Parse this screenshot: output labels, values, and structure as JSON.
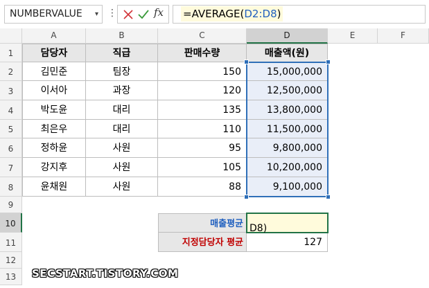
{
  "formula_bar": {
    "name_box": "NUMBERVALUE",
    "formula_prefix": "=AVERAGE(",
    "formula_ref": "D2:D8",
    "formula_suffix": ")",
    "fx_label": "fx"
  },
  "columns": [
    "A",
    "B",
    "C",
    "D",
    "E",
    "F"
  ],
  "rows": [
    "1",
    "2",
    "3",
    "4",
    "5",
    "6",
    "7",
    "8",
    "9",
    "10",
    "11",
    "12",
    "13"
  ],
  "table": {
    "headers": [
      "담당자",
      "직급",
      "판매수량",
      "매출액(원)"
    ],
    "rows": [
      [
        "김민준",
        "팀장",
        "150",
        "15,000,000"
      ],
      [
        "이서아",
        "과장",
        "120",
        "12,500,000"
      ],
      [
        "박도윤",
        "대리",
        "135",
        "13,800,000"
      ],
      [
        "최은우",
        "대리",
        "110",
        "11,500,000"
      ],
      [
        "정하윤",
        "사원",
        "95",
        "9,800,000"
      ],
      [
        "강지후",
        "사원",
        "105",
        "10,200,000"
      ],
      [
        "윤채원",
        "사원",
        "88",
        "9,100,000"
      ]
    ]
  },
  "summary": {
    "sales_avg_label": "매출평균",
    "sales_avg_editing": "D8)",
    "designated_avg_label": "지정담당자 평균",
    "designated_avg_value": "127"
  },
  "watermark": "SECSTART.TISTORY.COM",
  "colors": {
    "selection_blue": "#2f6fb8",
    "active_green": "#217346",
    "label_blue": "#1f5fbf",
    "label_red": "#c00000"
  }
}
